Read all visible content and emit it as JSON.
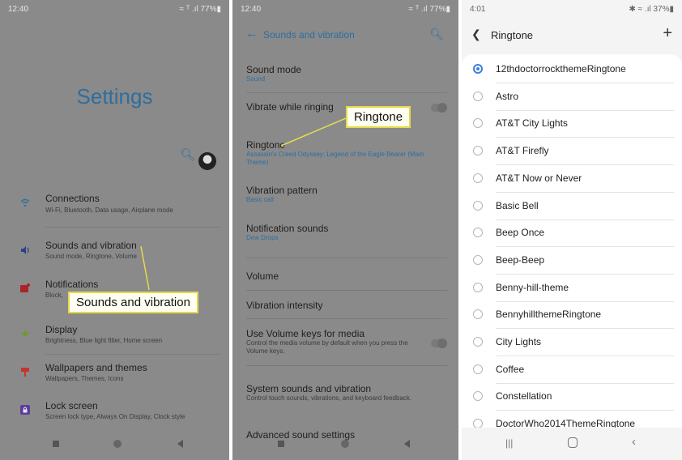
{
  "panel1": {
    "time": "12:40",
    "status_right": "≈ ᵀ .ıl 77%▮",
    "title": "Settings",
    "items": [
      {
        "title": "Connections",
        "sub": "Wi-Fi, Bluetooth, Data usage, Airplane mode"
      },
      {
        "title": "Sounds and vibration",
        "sub": "Sound mode, Ringtone, Volume"
      },
      {
        "title": "Notifications",
        "sub": "Block,"
      },
      {
        "title": "Display",
        "sub": "Brightness, Blue light filter, Home screen"
      },
      {
        "title": "Wallpapers and themes",
        "sub": "Wallpapers, Themes, Icons"
      },
      {
        "title": "Lock screen",
        "sub": "Screen lock type, Always On Display, Clock style"
      }
    ],
    "callout": "Sounds and vibration"
  },
  "panel2": {
    "time": "12:40",
    "status_right": "≈ ᵀ .ıl 77%▮",
    "header_title": "Sounds and vibration",
    "rows": [
      {
        "title": "Sound mode",
        "sub": "Sound"
      },
      {
        "title": "Vibrate while ringing",
        "sub": ""
      },
      {
        "title": "Ringtone",
        "sub": "Assassin's Creed Odyssey: Legend of the Eagle Bearer (Main Theme)"
      },
      {
        "title": "Vibration pattern",
        "sub": "Basic call"
      },
      {
        "title": "Notification sounds",
        "sub": "Dew Drops"
      },
      {
        "title": "Volume",
        "sub": ""
      },
      {
        "title": "Vibration intensity",
        "sub": ""
      },
      {
        "title": "Use Volume keys for media",
        "sub": "Control the media volume by default when you press the Volume keys."
      },
      {
        "title": "System sounds and vibration",
        "sub": "Control touch sounds, vibrations, and keyboard feedback."
      },
      {
        "title": "Advanced sound settings",
        "sub": ""
      }
    ],
    "callout": "Ringtone"
  },
  "panel3": {
    "time": "4:01",
    "status_right": "✱ ≈ .ıl 37%▮",
    "header_title": "Ringtone",
    "selected_index": 0,
    "tones": [
      "12thdoctorrockthemeRingtone",
      "Astro",
      "AT&T City Lights",
      "AT&T Firefly",
      "AT&T Now or Never",
      "Basic Bell",
      "Beep Once",
      "Beep-Beep",
      "Benny-hill-theme",
      "BennyhillthemeRingtone",
      "City Lights",
      "Coffee",
      "Constellation",
      "DoctorWho2014ThemeRingtone"
    ]
  },
  "icons": {
    "search": "search-icon",
    "back": "back-arrow-icon",
    "add": "plus-icon"
  },
  "colors": {
    "accent": "#2d6ea0",
    "radio_selected": "#3f7fd8",
    "callout_border": "#e5da4a"
  }
}
